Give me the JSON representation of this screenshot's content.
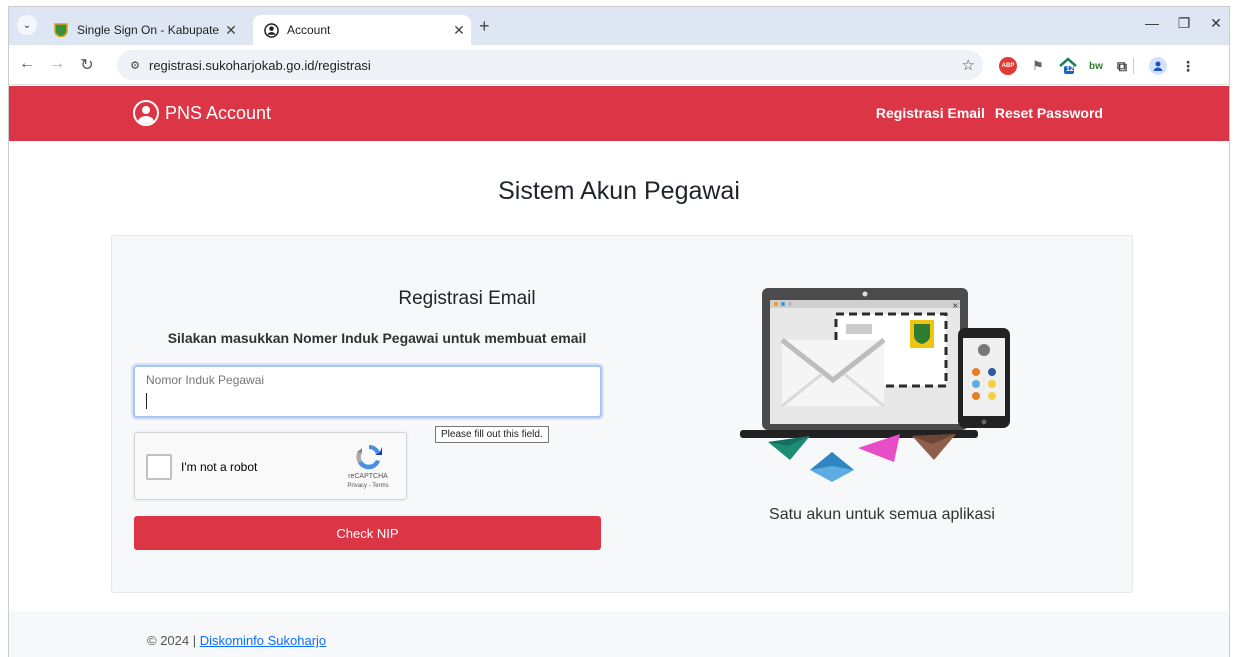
{
  "browser": {
    "tabs": [
      {
        "title": "Single Sign On - Kabupaten Sul",
        "active": false
      },
      {
        "title": "Account",
        "active": true
      }
    ],
    "url": "registrasi.sukoharjokab.go.id/registrasi",
    "extensions": {
      "abp": "ABP",
      "badge": "12",
      "bw": "bw"
    }
  },
  "app": {
    "brand": "PNS Account",
    "nav": {
      "registrasi_email": "Registrasi Email",
      "reset_password": "Reset Password"
    },
    "colors": {
      "primary": "#dc3545"
    }
  },
  "page": {
    "title": "Sistem Akun Pegawai",
    "form": {
      "heading": "Registrasi Email",
      "subheading": "Silakan masukkan Nomer Induk Pegawai untuk membuat email",
      "nip_placeholder": "Nomor Induk Pegawai",
      "nip_value": "",
      "validation_tooltip": "Please fill out this field.",
      "recaptcha_label": "I'm not a robot",
      "recaptcha_brand": "reCAPTCHA",
      "recaptcha_terms": "Privacy - Terms",
      "submit_label": "Check NIP"
    },
    "tagline": "Satu akun untuk semua aplikasi"
  },
  "footer": {
    "copyright": "© 2024 | ",
    "link_text": "Diskominfo Sukoharjo"
  }
}
